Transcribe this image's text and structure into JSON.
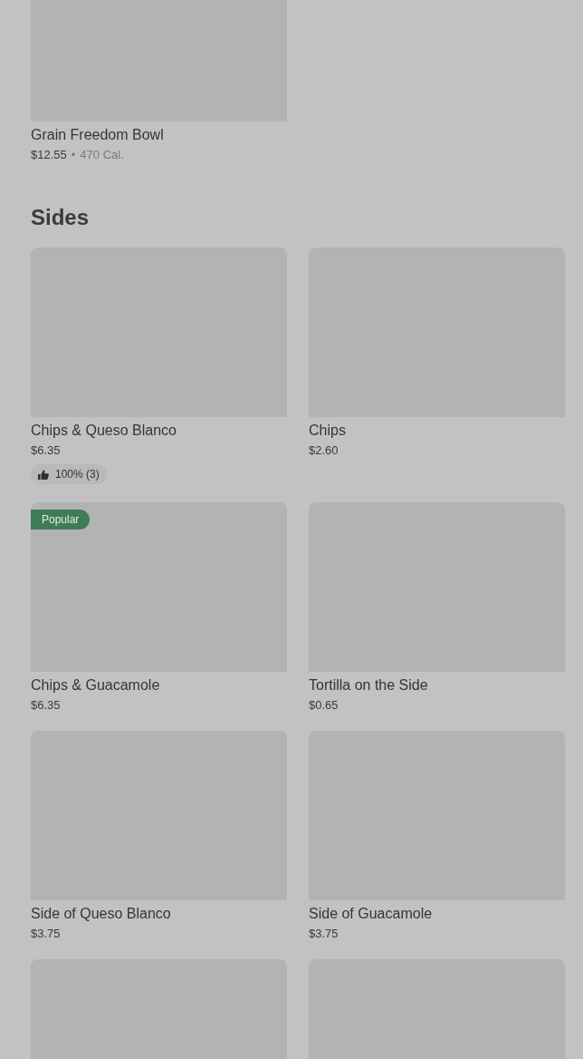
{
  "top_item": {
    "name": "Grain Freedom Bowl",
    "price": "$12.55",
    "separator": "•",
    "calories": "470 Cal."
  },
  "section": {
    "title": "Sides",
    "items": [
      {
        "kind": "full",
        "name": "Chips & Queso Blanco",
        "price": "$6.35",
        "rating": "100% (3)"
      },
      {
        "kind": "full",
        "name": "Chips",
        "price": "$2.60"
      },
      {
        "kind": "full",
        "name": "Chips & Guacamole",
        "price": "$6.35",
        "badge": "Popular"
      },
      {
        "kind": "full",
        "name": "Tortilla on the Side",
        "price": "$0.65"
      },
      {
        "kind": "full",
        "name": "Side of Queso Blanco",
        "price": "$3.75"
      },
      {
        "kind": "full",
        "name": "Side of Guacamole",
        "price": "$3.75"
      },
      {
        "kind": "cut"
      },
      {
        "kind": "cut"
      }
    ]
  }
}
